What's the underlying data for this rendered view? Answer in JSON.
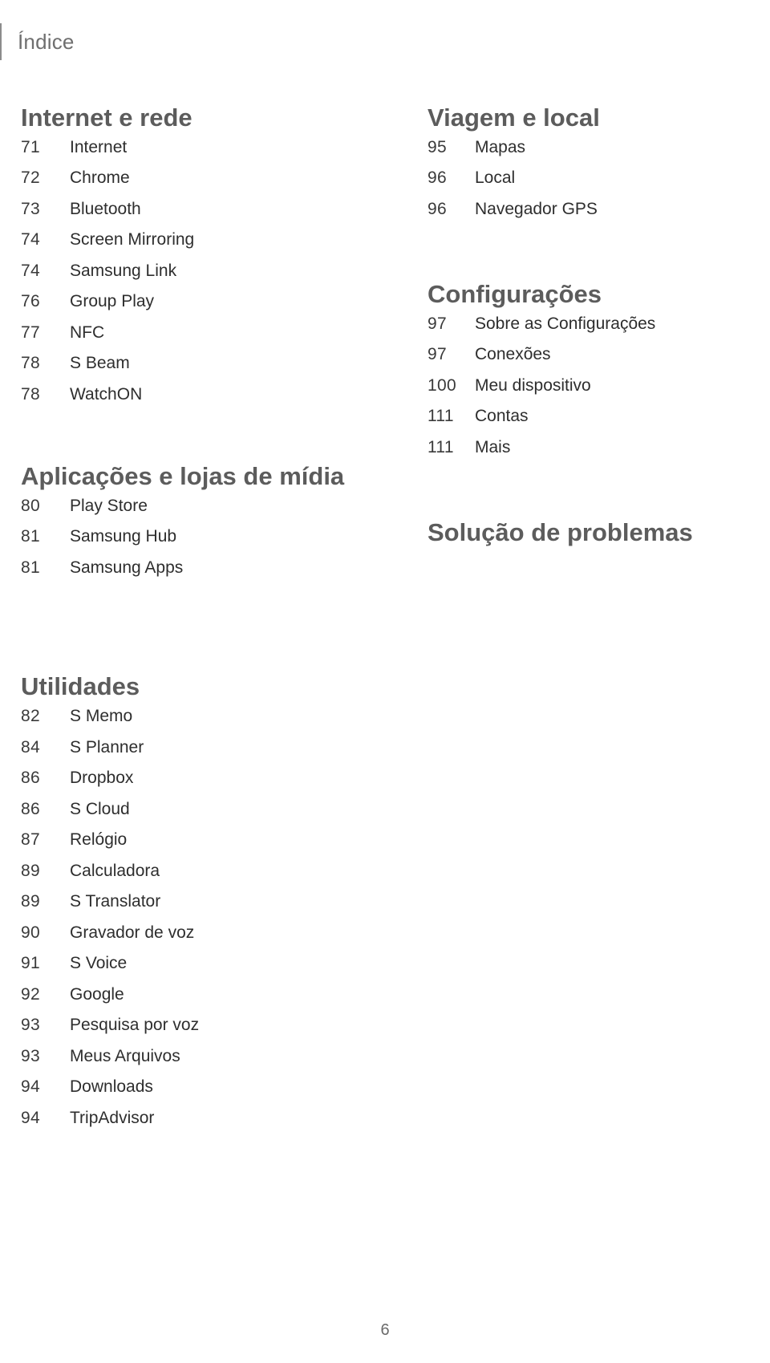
{
  "header": {
    "title": "Índice"
  },
  "footer": {
    "page_number": "6"
  },
  "colors": {
    "section_heading": "#5c5c5c",
    "header_title": "#6f6f6f",
    "body_text": "#2e2e2e",
    "page_number": "#3a3a3a",
    "rule": "#8c8c8c"
  },
  "left_column": {
    "sections": [
      {
        "title": "Internet e rede",
        "entries": [
          {
            "page": "71",
            "label": "Internet"
          },
          {
            "page": "72",
            "label": "Chrome"
          },
          {
            "page": "73",
            "label": "Bluetooth"
          },
          {
            "page": "74",
            "label": "Screen Mirroring"
          },
          {
            "page": "74",
            "label": "Samsung Link"
          },
          {
            "page": "76",
            "label": "Group Play"
          },
          {
            "page": "77",
            "label": "NFC"
          },
          {
            "page": "78",
            "label": "S Beam"
          },
          {
            "page": "78",
            "label": "WatchON"
          }
        ]
      },
      {
        "title": "Aplicações e lojas de mídia",
        "entries": [
          {
            "page": "80",
            "label": "Play Store"
          },
          {
            "page": "81",
            "label": "Samsung Hub"
          },
          {
            "page": "81",
            "label": "Samsung Apps"
          }
        ]
      },
      {
        "title": "Utilidades",
        "entries": [
          {
            "page": "82",
            "label": "S Memo"
          },
          {
            "page": "84",
            "label": "S Planner"
          },
          {
            "page": "86",
            "label": "Dropbox"
          },
          {
            "page": "86",
            "label": "S Cloud"
          },
          {
            "page": "87",
            "label": "Relógio"
          },
          {
            "page": "89",
            "label": "Calculadora"
          },
          {
            "page": "89",
            "label": "S Translator"
          },
          {
            "page": "90",
            "label": "Gravador de voz"
          },
          {
            "page": "91",
            "label": "S Voice"
          },
          {
            "page": "92",
            "label": "Google"
          },
          {
            "page": "93",
            "label": "Pesquisa por voz"
          },
          {
            "page": "93",
            "label": "Meus Arquivos"
          },
          {
            "page": "94",
            "label": "Downloads"
          },
          {
            "page": "94",
            "label": "TripAdvisor"
          }
        ]
      }
    ]
  },
  "right_column": {
    "sections": [
      {
        "title": "Viagem e local",
        "entries": [
          {
            "page": "95",
            "label": "Mapas"
          },
          {
            "page": "96",
            "label": "Local"
          },
          {
            "page": "96",
            "label": "Navegador GPS"
          }
        ]
      },
      {
        "title": "Configurações",
        "entries": [
          {
            "page": "97",
            "label": "Sobre as Configurações"
          },
          {
            "page": "97",
            "label": "Conexões"
          },
          {
            "page": "100",
            "label": "Meu dispositivo"
          },
          {
            "page": "111",
            "label": "Contas"
          },
          {
            "page": "111",
            "label": "Mais"
          }
        ]
      },
      {
        "title": "Solução de problemas",
        "entries": []
      }
    ]
  }
}
